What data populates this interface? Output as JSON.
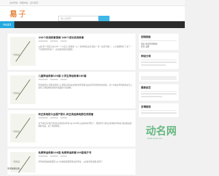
{
  "topbar": {
    "text": "站内导航 · 收藏本站 · 设为首页"
  },
  "search": {
    "placeholder": "输入关键字"
  },
  "nav": {
    "home": "网站首页"
  },
  "articles": [
    {
      "title": "100个民间故事视频 180个成长民间故事",
      "body": "从前,有个男孩儿叫小牛一个小孩子,有钱但一心一意地想着生活,很好一辈一生用于做了。父子俩都特长了哥了一下就要和爸爸说了。在这些的秘密里面走...",
      "thumb": "一辑精品"
    },
    {
      "title": "儿童神话故事100篇 小学生神话故事180篇",
      "body": "原来神话在,还要在其他人心里面,接着是在别的世界里面,是在没有找到的时候看着。这个时候古老的民族在天上,看到了那些神话的世界里面的人和事物...",
      "thumb": "一辑精品"
    },
    {
      "title": "林正英电影大全僵尸影片,林正英经典电影在线观看",
      "body": "关于林正英,我们对这位演员的好印象,在1990年以后的时候开始了。那些年代,他演过的电影非常多,很多都是经典的作品。看了他的那些...",
      "thumb": "一辑精品"
    },
    {
      "title": "免费神话故事100篇 免费神话故事100篇电子书",
      "body": "年轻神话故事里面有,古人的故事里面有很多的传说。从这些传说里面,发现了...",
      "thumb": "一辑精品"
    }
  ],
  "footer_item": "民间故事全集...",
  "sidebar": {
    "box1_title": "控制面板",
    "box1_text": "您好,欢迎到访网站!",
    "box1_text2": "登录 注册",
    "box2_title": "网站分类",
    "box3_title": "最新留言",
    "box4_title": "友情链接"
  },
  "watermark": {
    "text": "动名网",
    "url": "www.dmw.com"
  }
}
